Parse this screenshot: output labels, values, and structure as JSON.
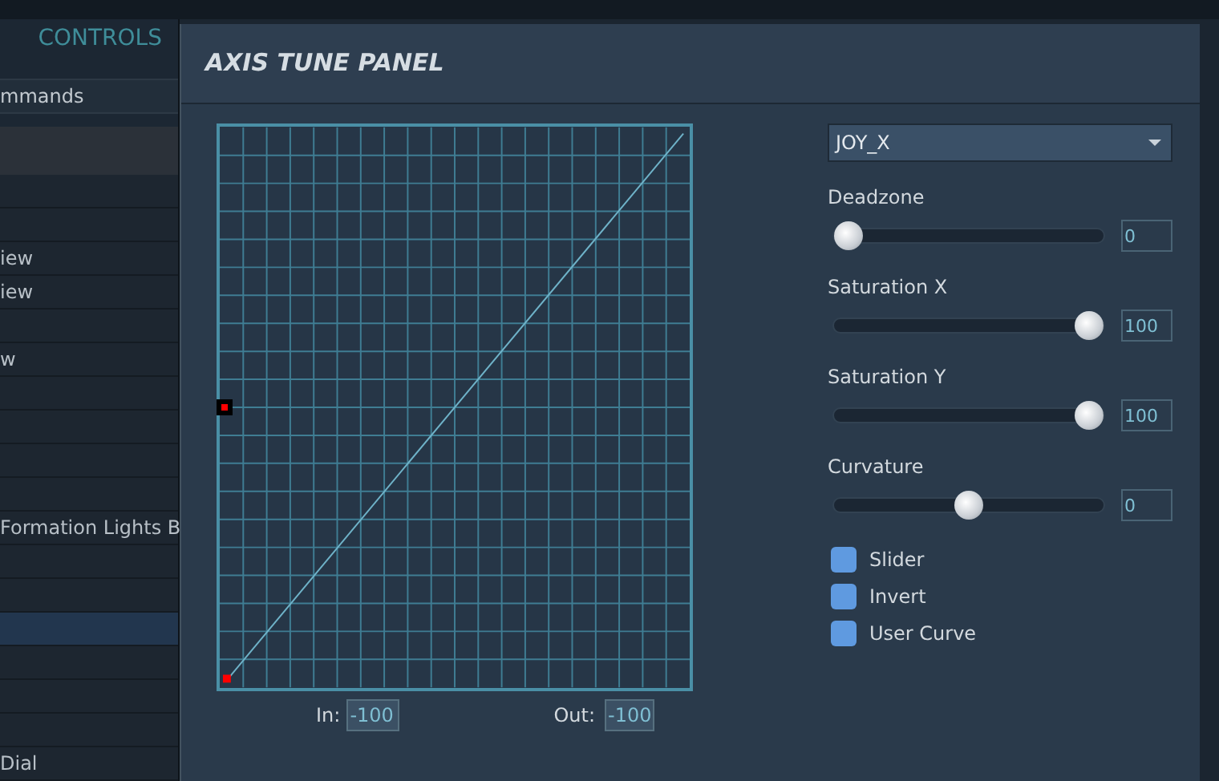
{
  "sidebar": {
    "title": "CONTROLS",
    "category": "mmands",
    "rows": [
      {
        "selected": false
      },
      {
        "selected": false
      },
      {
        "label": "iew",
        "selected": false
      },
      {
        "label": "iew",
        "selected": false
      },
      {
        "selected": false
      },
      {
        "label": "w",
        "selected": false
      },
      {
        "selected": false
      },
      {
        "selected": false
      },
      {
        "selected": false
      },
      {
        "selected": false
      },
      {
        "label": "Formation Lights B",
        "selected": false
      },
      {
        "selected": false
      },
      {
        "selected": false
      },
      {
        "selected": true
      },
      {
        "selected": false
      },
      {
        "selected": false
      },
      {
        "selected": false
      },
      {
        "label": "Dial",
        "selected": false
      }
    ]
  },
  "dialog": {
    "title": "AXIS TUNE PANEL",
    "axis": "JOY_X",
    "sliders": [
      {
        "label": "Deadzone",
        "level": 0,
        "value": "0"
      },
      {
        "label": "Saturation X",
        "level": 1,
        "value": "100"
      },
      {
        "label": "Saturation Y",
        "level": 1,
        "value": "100"
      },
      {
        "label": "Curvature",
        "level": 0.5,
        "value": "0"
      }
    ],
    "options": [
      {
        "label": "Slider",
        "checked": false
      },
      {
        "label": "Invert",
        "checked": false
      },
      {
        "label": "User Curve",
        "checked": false
      }
    ],
    "in": {
      "label": "In:",
      "value": "-100"
    },
    "out": {
      "label": "Out:",
      "value": "-100"
    }
  }
}
